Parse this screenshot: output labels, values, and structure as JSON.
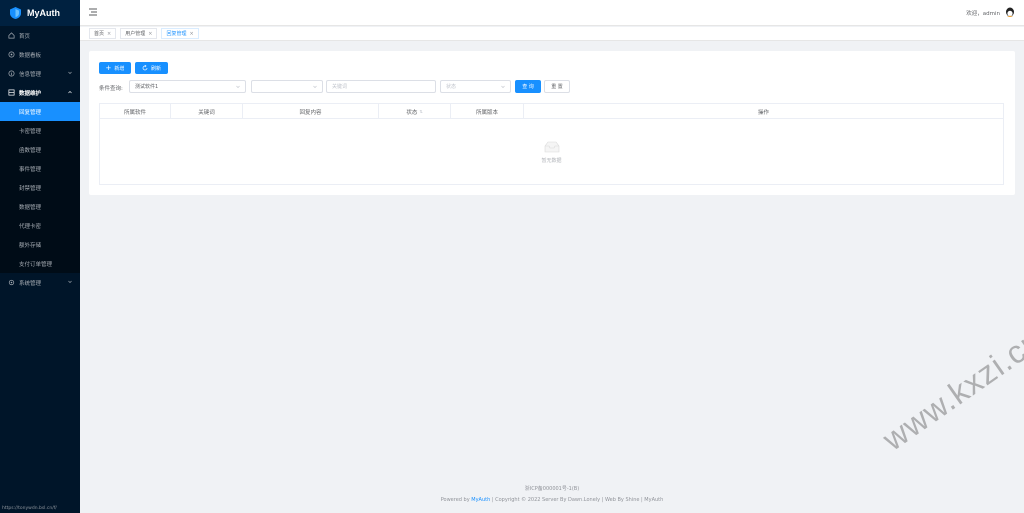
{
  "app": {
    "name": "MyAuth",
    "status_url": "https://tonywdn.bsl.cn/f/"
  },
  "sidebar": {
    "items": [
      {
        "label": "首页",
        "icon": "home-icon"
      },
      {
        "label": "数据看板",
        "icon": "dashboard-icon"
      },
      {
        "label": "信息管理",
        "icon": "info-icon",
        "expandable": true
      },
      {
        "label": "数据维护",
        "icon": "database-icon",
        "expandable": true,
        "open": true
      },
      {
        "label": "系统管理",
        "icon": "gear-icon",
        "expandable": true
      }
    ],
    "sub_items": [
      "回复管理",
      "卡密管理",
      "函数管理",
      "事件管理",
      "封禁管理",
      "数据管理",
      "代理卡密",
      "额外存储",
      "支付订单管理"
    ],
    "active_sub": "回复管理"
  },
  "header": {
    "welcome": "欢迎，admin"
  },
  "tabs": [
    {
      "label": "首页",
      "close": "×"
    },
    {
      "label": "用户管理",
      "close": "×"
    },
    {
      "label": "回复管理",
      "close": "×",
      "active": true
    }
  ],
  "toolbar": {
    "add_label": "新增",
    "refresh_label": "刷新"
  },
  "filters": {
    "label": "条件查询:",
    "software_select": "测试软件1",
    "second_select": "",
    "keyword_placeholder": "关键词",
    "status_placeholder": "状态",
    "query_label": "查 询",
    "reset_label": "重 置"
  },
  "table": {
    "columns": [
      "所属软件",
      "关键词",
      "回复内容",
      "状态",
      "所属版本",
      "操作"
    ],
    "empty_text": "暂无数据"
  },
  "footer": {
    "icp": "浙ICP备000001号-1(B)",
    "powered_prefix": "Powered by",
    "powered_link": "MyAuth",
    "rest": "| Copyright © 2022 Server By Dawn.Lonely | Web By Shine | MyAuth"
  },
  "watermark": "www.kxzi.cn",
  "colors": {
    "primary": "#1890ff",
    "sidebar_bg": "#001529"
  }
}
